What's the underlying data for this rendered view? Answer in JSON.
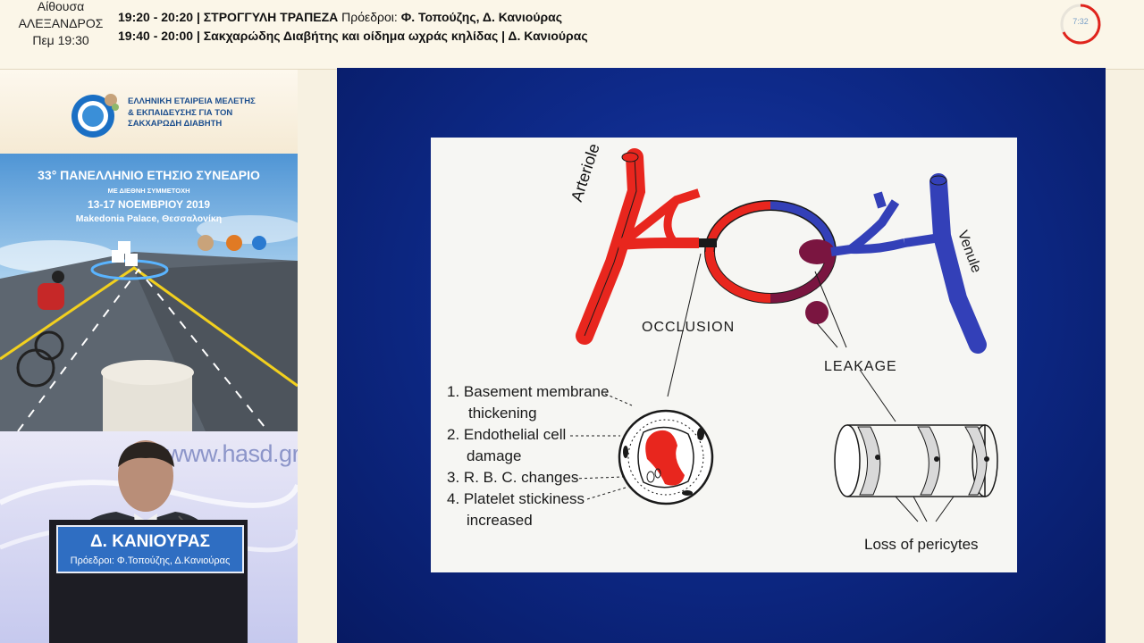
{
  "header": {
    "room_line1": "Αίθουσα",
    "room_line2": "ΑΛΕΞΑΝΔΡΟΣ",
    "room_line3": "Πεμ 19:30",
    "row1_time": "19:20 - 20:20 |",
    "row1_title": "ΣΤΡΟΓΓΥΛΗ ΤΡΑΠΕΖΑ",
    "row1_chairs_label": "Πρόεδροι:",
    "row1_chairs": "Φ. Τοπούζης, Δ. Κανιούρας",
    "row2_time": "19:40 - 20:00 |",
    "row2_title": "Σακχαρώδης Διαβήτης και οίδημα ωχράς κηλίδας | Δ. Κανιούρας",
    "timer": "7:32"
  },
  "sidebar": {
    "logo_line1": "ΕΛΛΗΝΙΚΗ ΕΤΑΙΡΕΙΑ ΜΕΛΕΤΗΣ",
    "logo_line2": "& ΕΚΠΑΙΔΕΥΣΗΣ ΓΙΑ ΤΟΝ",
    "logo_line3": "ΣΑΚΧΑΡΩΔΗ ΔΙΑΒΗΤΗ",
    "poster_title": "33° ΠΑΝΕΛΛΗΝΙΟ ΕΤΗΣΙΟ ΣΥΝΕΔΡΙΟ",
    "poster_sub": "ΜΕ ΔΙΕΘΝΗ ΣΥΜΜΕΤΟΧΗ",
    "poster_dates": "13-17 ΝΟΕΜΒΡΙΟΥ 2019",
    "poster_venue": "Makedonia Palace, Θεσσαλονίκη",
    "website": "www.hasd.gr",
    "speaker_name": "Δ. ΚΑΝΙΟΥΡΑΣ",
    "speaker_role": "Πρόεδροι: Φ.Τοπούζης, Δ.Κανιούρας"
  },
  "slide": {
    "arteriole": "Arteriole",
    "venule": "Venule",
    "occlusion": "OCCLUSION",
    "leakage": "LEAKAGE",
    "item1_num": "1.",
    "item1_a": "Basement membrane",
    "item1_b": "thickening",
    "item2_num": "2.",
    "item2_a": "Endothelial cell",
    "item2_b": "damage",
    "item3_num": "3.",
    "item3": "R. B. C. changes",
    "item4_num": "4.",
    "item4_a": "Platelet stickiness",
    "item4_b": "increased",
    "pericytes": "Loss of pericytes"
  },
  "colors": {
    "arterial": "#e8261e",
    "venous": "#3340b8",
    "timer_ring": "#e0241c",
    "slide_bg": "#0e2a8a"
  }
}
